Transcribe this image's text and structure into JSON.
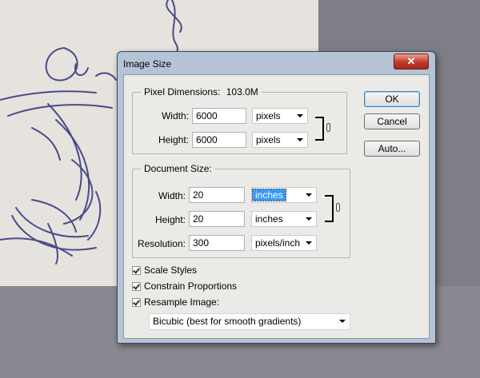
{
  "dialog": {
    "title": "Image Size",
    "close_glyph": "✕"
  },
  "pixel_dimensions": {
    "label": "Pixel Dimensions:",
    "size": "103.0M",
    "width_label": "Width:",
    "width_value": "6000",
    "width_unit": "pixels",
    "height_label": "Height:",
    "height_value": "6000",
    "height_unit": "pixels"
  },
  "document_size": {
    "label": "Document Size:",
    "width_label": "Width:",
    "width_value": "20",
    "width_unit": "inches",
    "height_label": "Height:",
    "height_value": "20",
    "height_unit": "inches",
    "resolution_label": "Resolution:",
    "resolution_value": "300",
    "resolution_unit": "pixels/inch"
  },
  "buttons": {
    "ok": "OK",
    "cancel": "Cancel",
    "auto": "Auto..."
  },
  "options": {
    "scale_styles": "Scale Styles",
    "constrain_proportions": "Constrain Proportions",
    "resample_image": "Resample Image:",
    "resample_method": "Bicubic (best for smooth gradients)"
  },
  "icons": {
    "link": "chain-link-icon",
    "dropdown": "chevron-down-icon",
    "close": "close-icon"
  },
  "colors": {
    "selection": "#3399ff",
    "title_bar": "#b4c4d6",
    "close_button": "#c0392b"
  }
}
